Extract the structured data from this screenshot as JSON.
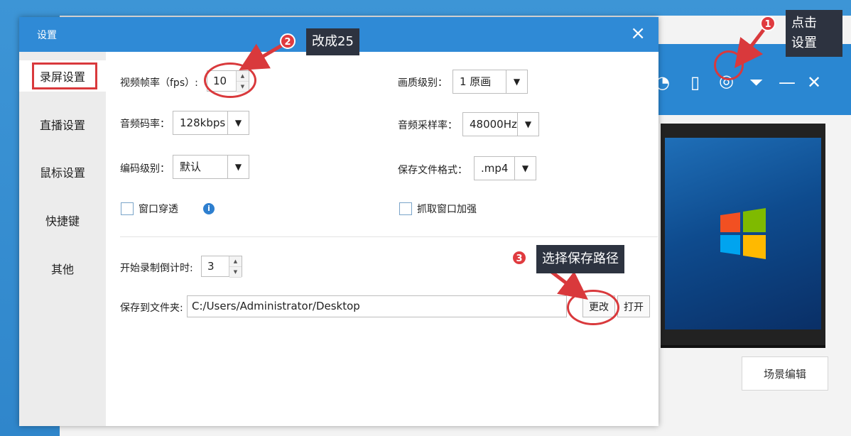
{
  "dialog": {
    "title": "设置",
    "close_icon": "×"
  },
  "sidebar": {
    "items": [
      {
        "label": "录屏设置",
        "active": true
      },
      {
        "label": "直播设置",
        "active": false
      },
      {
        "label": "鼠标设置",
        "active": false
      },
      {
        "label": "快捷键",
        "active": false
      },
      {
        "label": "其他",
        "active": false
      }
    ]
  },
  "settings": {
    "fps_label": "视频帧率（fps）:",
    "fps_value": "10",
    "quality_label": "画质级别：",
    "quality_value": "1 原画",
    "audio_bitrate_label": "音频码率：",
    "audio_bitrate_value": "128kbps",
    "sample_rate_label": "音频采样率：",
    "sample_rate_value": "48000Hz",
    "encoder_label": "编码级别：",
    "encoder_value": "默认",
    "format_label": "保存文件格式：",
    "format_value": ".mp4",
    "window_pass_label": "窗口穿透",
    "window_capture_label": "抓取窗口加强",
    "countdown_label": "开始录制倒计时:",
    "countdown_value": "3",
    "folder_label": "保存到文件夹:",
    "folder_value": "C:/Users/Administrator/Desktop",
    "change_button": "更改",
    "open_button": "打开"
  },
  "annotations": {
    "badge_1": "1",
    "callout_1": "点击\n设置",
    "badge_2": "2",
    "callout_2": "改成25",
    "badge_3": "3",
    "callout_3": "选择保存路径",
    "accent_red": "#d9393c"
  },
  "background": {
    "scene_button": "场景编辑"
  }
}
